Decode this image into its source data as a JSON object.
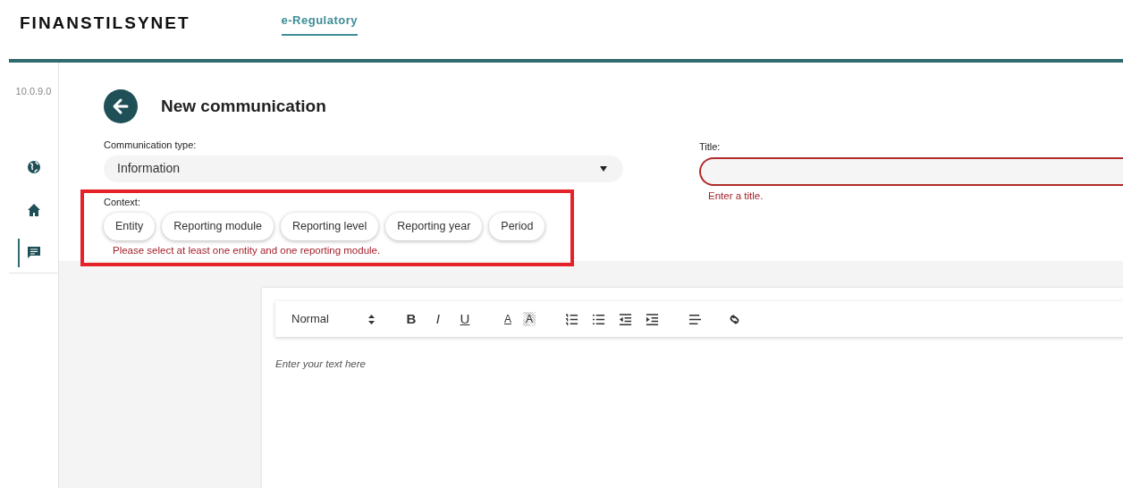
{
  "header": {
    "logo": "FINANSTILSYNET",
    "tabs": [
      {
        "label": "e-Regulatory",
        "selected": true
      }
    ]
  },
  "sidebar": {
    "version": "10.0.9.0",
    "items": [
      {
        "kind": "globe",
        "selected": false
      },
      {
        "kind": "home",
        "selected": false
      },
      {
        "kind": "chat",
        "selected": true
      }
    ]
  },
  "page_title": "New communication",
  "communication_type": {
    "label": "Communication type:",
    "value": "Information"
  },
  "title_field": {
    "label": "Title:",
    "error": "Enter a title.",
    "invalid": true
  },
  "context": {
    "label": "Context:",
    "highlighted": true,
    "chips": [
      "Entity",
      "Reporting module",
      "Reporting level",
      "Reporting year",
      "Period"
    ],
    "error": "Please select at least one entity and one reporting module."
  },
  "editor": {
    "format": "Normal",
    "tools": [
      {
        "kind": "bold",
        "label": "B"
      },
      {
        "kind": "italic",
        "label": "I"
      },
      {
        "kind": "underline",
        "label": "U"
      },
      {
        "kind": "color",
        "label": "A"
      },
      {
        "kind": "background",
        "label": "A"
      },
      {
        "kind": "ordered"
      },
      {
        "kind": "bullet"
      },
      {
        "kind": "outdent"
      },
      {
        "kind": "indent"
      },
      {
        "kind": "align"
      },
      {
        "kind": "link"
      }
    ],
    "placeholder": "Enter your text here"
  }
}
